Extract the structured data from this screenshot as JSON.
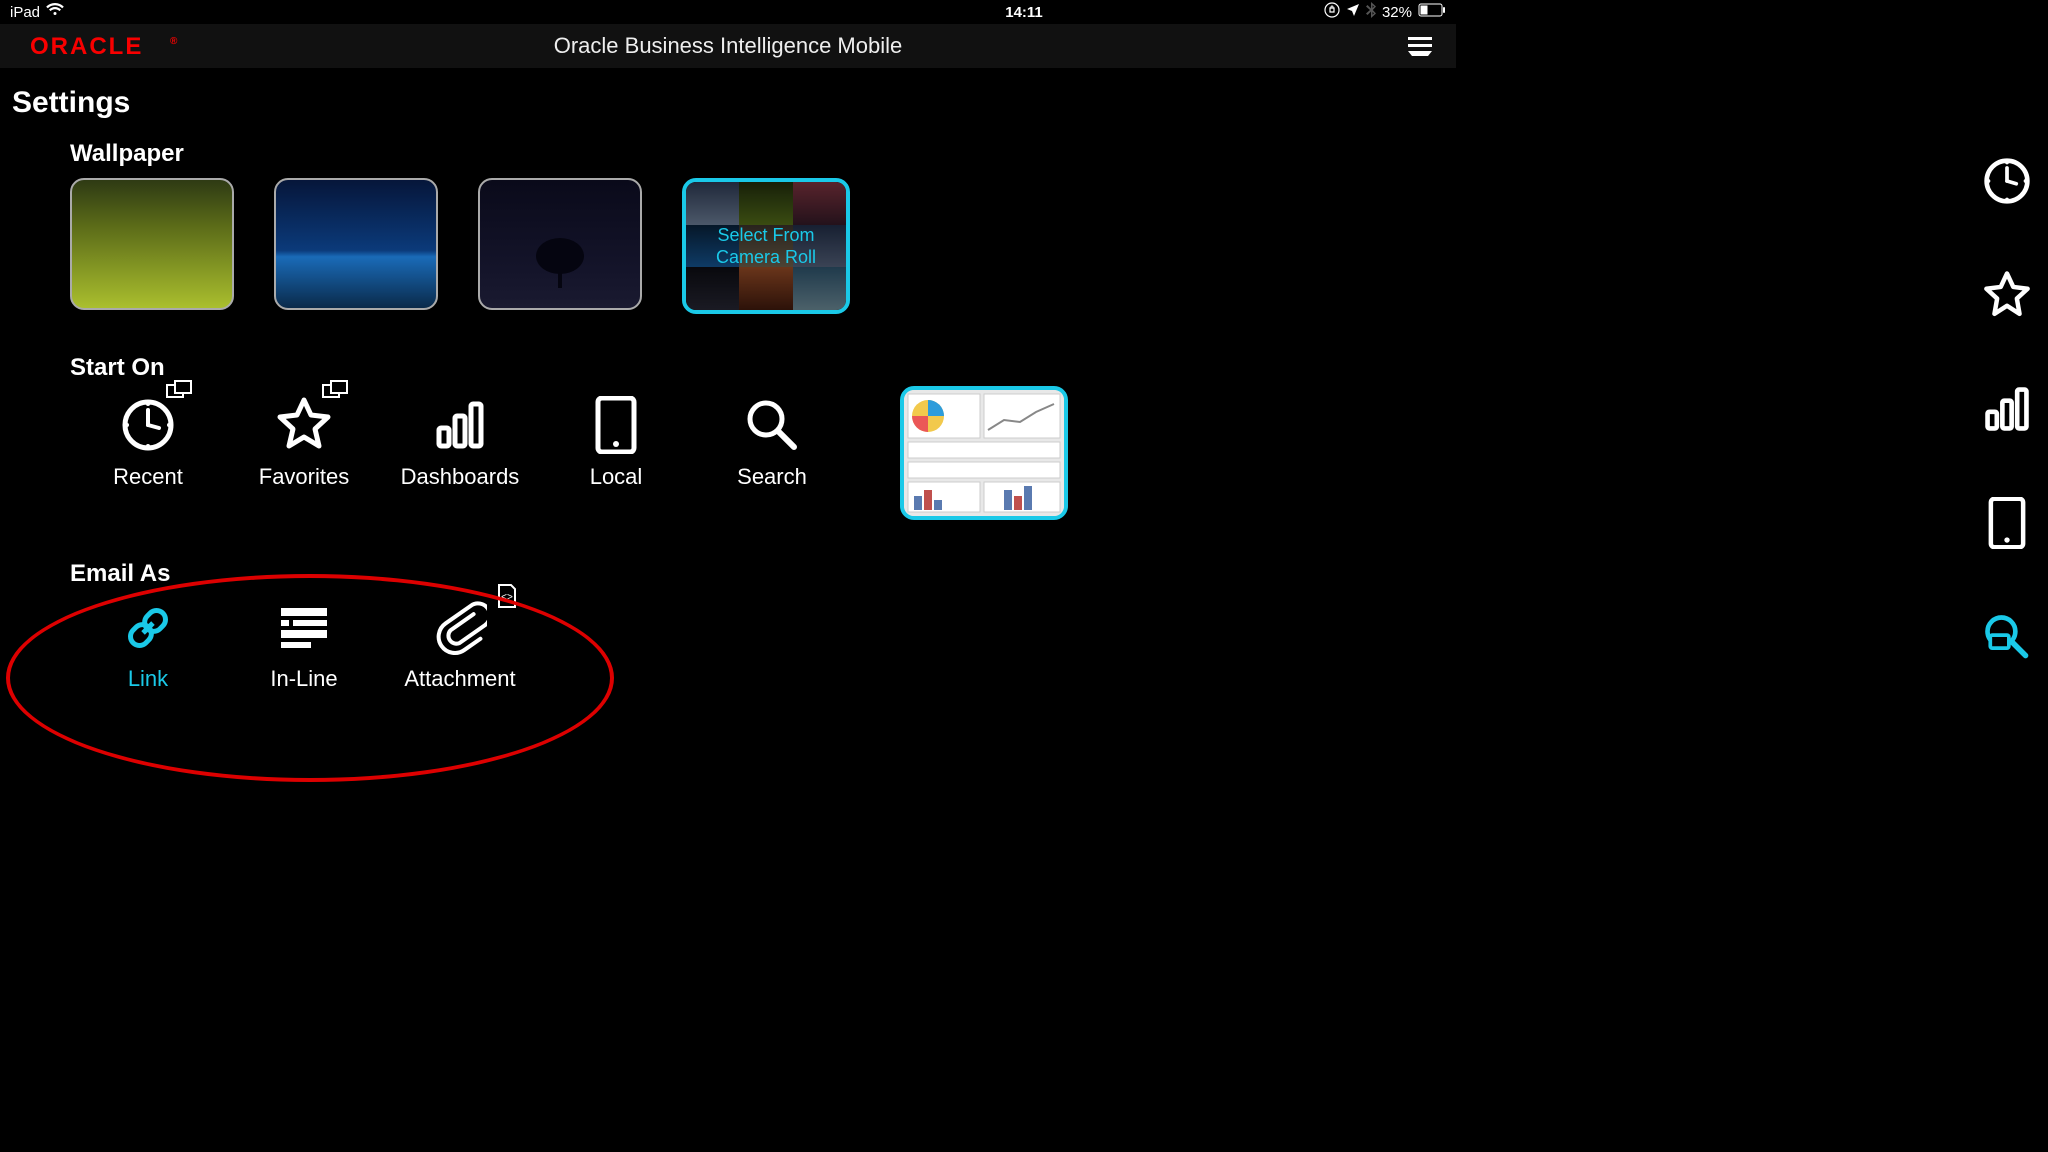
{
  "status": {
    "device": "iPad",
    "time": "14:11",
    "battery": "32%"
  },
  "header": {
    "brand": "ORACLE",
    "title": "Oracle Business Intelligence Mobile"
  },
  "page": {
    "title": "Settings"
  },
  "sections": {
    "wallpaper": {
      "title": "Wallpaper",
      "camera_roll": "Select From\nCamera Roll"
    },
    "start_on": {
      "title": "Start On",
      "items": {
        "recent": "Recent",
        "favorites": "Favorites",
        "dashboards": "Dashboards",
        "local": "Local",
        "search": "Search"
      }
    },
    "email_as": {
      "title": "Email As",
      "items": {
        "link": "Link",
        "inline": "In-Line",
        "attachment": "Attachment"
      }
    }
  },
  "colors": {
    "accent": "#1ac9e8",
    "brand_red": "#f80000"
  }
}
